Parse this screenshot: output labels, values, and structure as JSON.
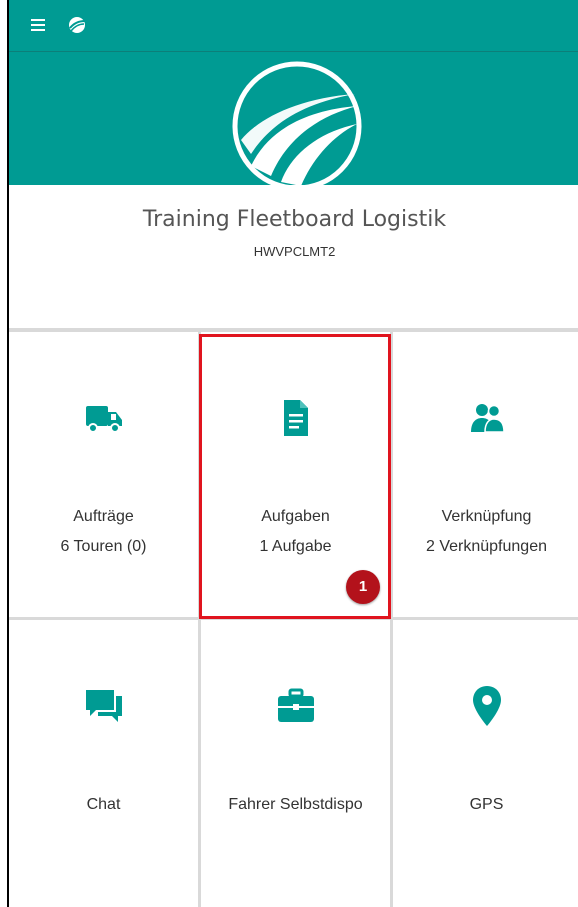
{
  "colors": {
    "brand": "#009b93",
    "highlight": "#e0141e",
    "badge": "#b3121b"
  },
  "header": {
    "title": "Training Fleetboard Logistik",
    "subtitle": "HWVPCLMT2"
  },
  "tiles": [
    {
      "label": "Aufträge",
      "sub": "6 Touren (0)",
      "icon": "truck-icon"
    },
    {
      "label": "Aufgaben",
      "sub": "1 Aufgabe",
      "icon": "document-icon"
    },
    {
      "label": "Verknüpfung",
      "sub": "2 Verknüpfungen",
      "icon": "people-icon"
    },
    {
      "label": "Chat",
      "sub": "",
      "icon": "chat-icon"
    },
    {
      "label": "Fahrer Selbstdispo",
      "sub": "",
      "icon": "briefcase-icon"
    },
    {
      "label": "GPS",
      "sub": "",
      "icon": "location-pin-icon"
    }
  ],
  "annotation": {
    "badge": "1"
  }
}
